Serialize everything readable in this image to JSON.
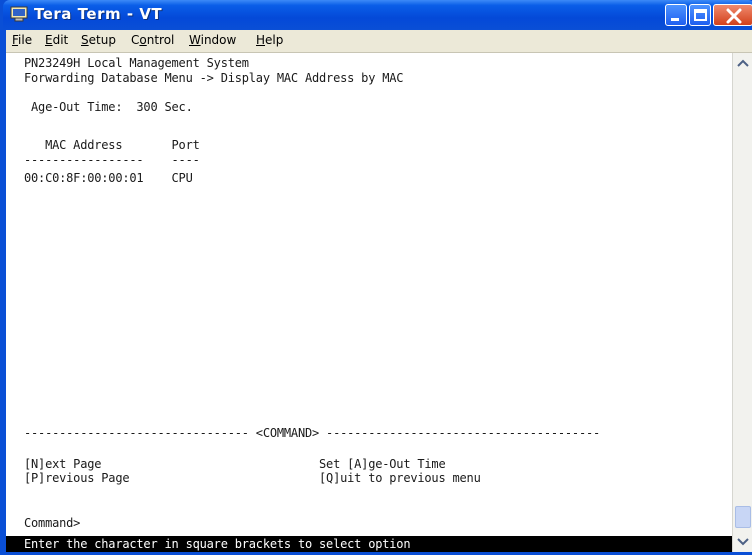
{
  "window": {
    "title": "Tera Term - VT",
    "accent_color": "#0a4fd6"
  },
  "menubar": {
    "items": [
      {
        "accel": "F",
        "rest": "ile"
      },
      {
        "accel": "E",
        "rest": "dit"
      },
      {
        "accel": "S",
        "rest": "etup"
      },
      {
        "pre": "C",
        "accel": "o",
        "rest": "ntrol"
      },
      {
        "accel": "W",
        "rest": "indow"
      },
      {
        "accel": "H",
        "rest": "elp"
      }
    ]
  },
  "terminal": {
    "header_line1": "PN23249H Local Management System",
    "header_line2": "Forwarding Database Menu -> Display MAC Address by MAC",
    "age_out_line": " Age-Out Time:  300 Sec.",
    "table": {
      "header": "   MAC Address       Port",
      "separator": "-----------------    ----",
      "rows": [
        "00:C0:8F:00:00:01    CPU"
      ]
    },
    "command_divider": "-------------------------------- <COMMAND> ---------------------------------------",
    "options_line1": "[N]ext Page                               Set [A]ge-Out Time",
    "options_line2": "[P]revious Page                           [Q]uit to previous menu",
    "prompt": "Command>",
    "status_message": "Enter the character in square brackets to select option"
  },
  "icons": {
    "app": "terminal-app-icon",
    "minimize": "minimize-icon",
    "maximize": "maximize-icon",
    "close": "close-icon",
    "scroll_up": "scroll-up-arrow-icon",
    "scroll_down": "scroll-down-arrow-icon"
  }
}
